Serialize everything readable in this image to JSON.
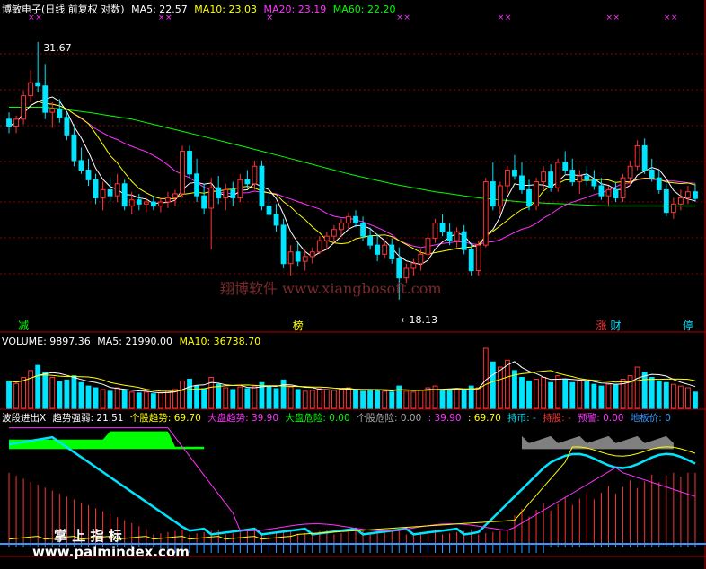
{
  "price_header": {
    "title": "博敏电子(日线 前复权 对数)",
    "ma5": "MA5: 22.57",
    "ma10": "MA10: 23.03",
    "ma20": "MA20: 23.19",
    "ma60": "MA60: 22.20"
  },
  "high_label": "31.67",
  "low_label": "←18.13",
  "price_markers": [
    "减",
    "榜",
    "涨",
    "财",
    "停"
  ],
  "volume_header": {
    "volume": "VOLUME: 9897.36",
    "ma5": "MA5: 21990.00",
    "ma10": "MA10: 36738.70"
  },
  "indicator_header": {
    "name": "波段进出X",
    "trend_strength": "趋势强弱: 21.51",
    "stock_trend": "个股趋势: 69.70",
    "market_trend": "大盘趋势: 39.90",
    "market_risk": "大盘危险: 0.00",
    "stock_risk": "个股危险: 0.00",
    "v1": ": 39.90",
    "v2": ": 69.70",
    "hold_coin": "持币: -",
    "hold_stock": "持股: -",
    "warning": "预警: 0.00",
    "floor_price": "地板价: 0"
  },
  "watermark_1": "翔博软件 www.xiangbosoft.com",
  "watermark_2": "掌 上 指 标",
  "watermark_3": "www.palmindex.com",
  "colors": {
    "up": "#ff3333",
    "down": "#00e5ff",
    "ma5": "#ffffff",
    "ma10": "#ffff00",
    "ma20": "#ff33ff",
    "ma60": "#00ff00",
    "grid": "#8b0000"
  },
  "chart_data": {
    "type": "candlestick",
    "scale": "log",
    "price_range": [
      17.5,
      33.5
    ],
    "ohlc": [
      [
        26.8,
        27.2,
        26.0,
        26.4
      ],
      [
        26.4,
        27.0,
        26.0,
        26.8
      ],
      [
        26.8,
        28.5,
        26.5,
        28.2
      ],
      [
        28.2,
        29.8,
        27.8,
        29.0
      ],
      [
        29.0,
        31.67,
        28.4,
        28.8
      ],
      [
        28.8,
        30.2,
        26.8,
        27.2
      ],
      [
        27.2,
        27.8,
        26.3,
        27.4
      ],
      [
        27.4,
        28.0,
        26.6,
        26.9
      ],
      [
        26.9,
        27.2,
        25.6,
        25.9
      ],
      [
        25.9,
        26.5,
        24.2,
        24.5
      ],
      [
        24.5,
        25.2,
        23.8,
        24.0
      ],
      [
        24.0,
        24.6,
        23.2,
        23.5
      ],
      [
        23.5,
        23.8,
        22.3,
        22.6
      ],
      [
        22.6,
        23.4,
        22.0,
        23.0
      ],
      [
        23.0,
        23.6,
        22.4,
        22.7
      ],
      [
        22.7,
        23.8,
        22.4,
        23.3
      ],
      [
        23.3,
        23.5,
        22.0,
        22.2
      ],
      [
        22.2,
        22.9,
        21.8,
        22.5
      ],
      [
        22.5,
        22.8,
        22.0,
        22.3
      ],
      [
        22.3,
        22.6,
        21.9,
        22.4
      ],
      [
        22.4,
        22.7,
        22.0,
        22.2
      ],
      [
        22.2,
        22.6,
        21.9,
        22.4
      ],
      [
        22.4,
        22.9,
        22.1,
        22.6
      ],
      [
        22.6,
        23.0,
        22.2,
        22.8
      ],
      [
        22.8,
        25.3,
        22.6,
        25.0
      ],
      [
        25.0,
        25.3,
        23.6,
        23.8
      ],
      [
        23.8,
        24.6,
        22.4,
        22.7
      ],
      [
        22.7,
        23.3,
        21.8,
        22.1
      ],
      [
        22.1,
        23.6,
        20.2,
        23.1
      ],
      [
        23.1,
        23.7,
        22.3,
        22.6
      ],
      [
        22.6,
        23.3,
        22.0,
        23.0
      ],
      [
        23.0,
        23.4,
        22.2,
        22.6
      ],
      [
        22.6,
        23.8,
        22.4,
        23.5
      ],
      [
        23.5,
        24.0,
        23.1,
        23.3
      ],
      [
        23.3,
        24.5,
        23.0,
        24.2
      ],
      [
        24.2,
        24.5,
        22.0,
        22.2
      ],
      [
        22.2,
        22.8,
        21.6,
        21.8
      ],
      [
        21.8,
        22.3,
        21.0,
        21.3
      ],
      [
        21.3,
        21.6,
        19.4,
        19.6
      ],
      [
        19.6,
        20.4,
        19.1,
        20.1
      ],
      [
        20.1,
        20.5,
        19.5,
        19.7
      ],
      [
        19.7,
        20.2,
        19.3,
        19.9
      ],
      [
        19.9,
        20.3,
        19.6,
        20.1
      ],
      [
        20.1,
        20.8,
        20.0,
        20.6
      ],
      [
        20.6,
        21.0,
        20.2,
        20.8
      ],
      [
        20.8,
        21.3,
        20.5,
        21.1
      ],
      [
        21.1,
        21.6,
        20.8,
        21.4
      ],
      [
        21.4,
        21.9,
        21.1,
        21.7
      ],
      [
        21.7,
        22.0,
        21.2,
        21.4
      ],
      [
        21.4,
        21.7,
        20.6,
        20.8
      ],
      [
        20.8,
        21.2,
        20.2,
        20.4
      ],
      [
        20.4,
        20.9,
        19.7,
        20.0
      ],
      [
        20.0,
        20.6,
        19.8,
        20.4
      ],
      [
        20.4,
        20.7,
        19.6,
        19.8
      ],
      [
        19.8,
        20.3,
        18.13,
        19.0
      ],
      [
        19.0,
        19.6,
        18.8,
        19.4
      ],
      [
        19.4,
        19.8,
        19.1,
        19.6
      ],
      [
        19.6,
        20.2,
        19.3,
        20.0
      ],
      [
        20.0,
        20.9,
        19.8,
        20.7
      ],
      [
        20.7,
        21.6,
        20.5,
        21.4
      ],
      [
        21.4,
        21.8,
        20.8,
        21.0
      ],
      [
        21.0,
        21.4,
        20.4,
        20.6
      ],
      [
        20.6,
        21.2,
        20.3,
        21.0
      ],
      [
        21.0,
        21.3,
        20.0,
        20.2
      ],
      [
        20.2,
        20.5,
        19.1,
        19.3
      ],
      [
        19.3,
        20.6,
        19.1,
        20.4
      ],
      [
        20.4,
        23.6,
        20.3,
        23.4
      ],
      [
        23.4,
        24.4,
        22.0,
        22.2
      ],
      [
        22.2,
        23.4,
        21.8,
        23.2
      ],
      [
        23.2,
        24.2,
        22.8,
        24.0
      ],
      [
        24.0,
        24.8,
        23.5,
        23.7
      ],
      [
        23.7,
        24.4,
        22.8,
        23.0
      ],
      [
        23.0,
        23.5,
        22.0,
        22.2
      ],
      [
        22.2,
        23.6,
        22.0,
        23.4
      ],
      [
        23.4,
        24.2,
        23.0,
        23.9
      ],
      [
        23.9,
        24.3,
        22.9,
        23.1
      ],
      [
        23.1,
        24.6,
        22.9,
        24.4
      ],
      [
        24.4,
        25.0,
        23.8,
        24.0
      ],
      [
        24.0,
        24.6,
        23.2,
        23.4
      ],
      [
        23.4,
        24.0,
        22.8,
        23.7
      ],
      [
        23.7,
        24.2,
        23.2,
        23.5
      ],
      [
        23.5,
        24.0,
        23.0,
        23.2
      ],
      [
        23.2,
        23.6,
        22.5,
        22.7
      ],
      [
        22.7,
        23.2,
        22.2,
        23.0
      ],
      [
        23.0,
        23.4,
        22.4,
        22.6
      ],
      [
        22.6,
        23.8,
        22.4,
        23.6
      ],
      [
        23.6,
        24.5,
        23.2,
        24.2
      ],
      [
        24.2,
        25.6,
        24.0,
        25.3
      ],
      [
        25.3,
        25.7,
        23.8,
        24.0
      ],
      [
        24.0,
        24.6,
        23.4,
        23.6
      ],
      [
        23.6,
        24.0,
        22.8,
        23.0
      ],
      [
        23.0,
        23.3,
        21.7,
        21.9
      ],
      [
        21.9,
        22.6,
        21.6,
        22.3
      ],
      [
        22.3,
        23.0,
        22.0,
        22.6
      ],
      [
        22.6,
        23.2,
        22.3,
        22.9
      ],
      [
        22.9,
        23.3,
        22.4,
        22.57
      ]
    ],
    "volume": [
      3.2,
      2.9,
      3.6,
      4.4,
      5.0,
      4.2,
      3.6,
      3.1,
      3.3,
      3.8,
      3.0,
      2.6,
      2.4,
      2.2,
      2.0,
      2.4,
      2.1,
      1.9,
      1.8,
      1.9,
      1.7,
      1.8,
      2.0,
      2.2,
      3.2,
      3.4,
      2.6,
      2.3,
      3.6,
      2.8,
      2.4,
      2.2,
      2.5,
      2.3,
      2.6,
      3.0,
      2.6,
      2.3,
      3.3,
      2.5,
      2.2,
      2.0,
      2.1,
      2.3,
      2.2,
      2.1,
      2.3,
      2.4,
      2.2,
      2.0,
      2.1,
      2.2,
      2.0,
      1.9,
      2.6,
      2.0,
      1.9,
      2.1,
      2.4,
      2.6,
      2.2,
      2.1,
      2.3,
      2.2,
      2.6,
      2.4,
      7.0,
      5.4,
      4.8,
      5.6,
      4.4,
      3.6,
      3.2,
      3.4,
      3.6,
      3.0,
      3.8,
      3.4,
      3.0,
      3.3,
      3.1,
      2.8,
      2.6,
      2.8,
      2.7,
      3.4,
      3.8,
      4.8,
      4.2,
      3.6,
      3.2,
      3.0,
      2.8,
      2.6,
      2.4,
      1.9
    ]
  }
}
